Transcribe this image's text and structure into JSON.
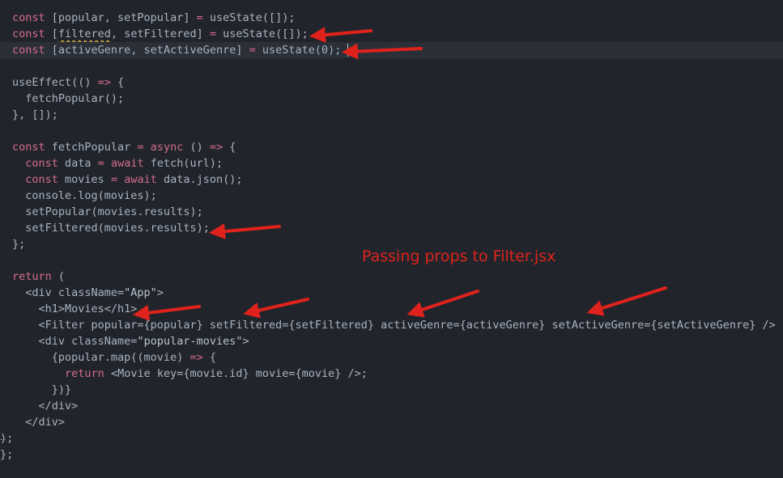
{
  "editor": {
    "lines": [
      [
        {
          "t": "const",
          "c": "kw"
        },
        {
          "t": " [popular, setPopular] "
        },
        {
          "t": "=",
          "c": "op"
        },
        {
          "t": " useState([]);"
        }
      ],
      [
        {
          "t": "const",
          "c": "kw"
        },
        {
          "t": " ["
        },
        {
          "t": "filtered",
          "c": "squiggle"
        },
        {
          "t": ", setFiltered] "
        },
        {
          "t": "=",
          "c": "op"
        },
        {
          "t": " useState([]);"
        }
      ],
      [
        {
          "t": "const",
          "c": "kw"
        },
        {
          "t": " [activeGenre, setActiveGenre] "
        },
        {
          "t": "=",
          "c": "op"
        },
        {
          "t": " useState(0);"
        },
        {
          "t": "",
          "c": "cursor"
        }
      ],
      [],
      [
        {
          "t": "useEffect(() "
        },
        {
          "t": "=>",
          "c": "op"
        },
        {
          "t": " {"
        }
      ],
      [
        {
          "t": "  fetchPopular();"
        }
      ],
      [
        {
          "t": "}, []);"
        }
      ],
      [],
      [
        {
          "t": "const",
          "c": "kw"
        },
        {
          "t": " fetchPopular "
        },
        {
          "t": "=",
          "c": "op"
        },
        {
          "t": " "
        },
        {
          "t": "async",
          "c": "kw"
        },
        {
          "t": " () "
        },
        {
          "t": "=>",
          "c": "op"
        },
        {
          "t": " {"
        }
      ],
      [
        {
          "t": "  "
        },
        {
          "t": "const",
          "c": "kw"
        },
        {
          "t": " data "
        },
        {
          "t": "=",
          "c": "op"
        },
        {
          "t": " "
        },
        {
          "t": "await",
          "c": "kw"
        },
        {
          "t": " fetch(url);"
        }
      ],
      [
        {
          "t": "  "
        },
        {
          "t": "const",
          "c": "kw"
        },
        {
          "t": " movies "
        },
        {
          "t": "=",
          "c": "op"
        },
        {
          "t": " "
        },
        {
          "t": "await",
          "c": "kw"
        },
        {
          "t": " data.json();"
        }
      ],
      [
        {
          "t": "  console.log(movies);"
        }
      ],
      [
        {
          "t": "  setPopular(movies.results);"
        }
      ],
      [
        {
          "t": "  setFiltered(movies.results);"
        }
      ],
      [
        {
          "t": "};"
        }
      ],
      [],
      [
        {
          "t": "return",
          "c": "kw"
        },
        {
          "t": " ("
        }
      ],
      [
        {
          "t": "  <div className="
        },
        {
          "t": "\"App\"",
          "c": "str"
        },
        {
          "t": ">"
        }
      ],
      [
        {
          "t": "    <h1>Movies</h1>"
        }
      ],
      [
        {
          "t": "    <Filter popular={popular} setFiltered={setFiltered} activeGenre={activeGenre} setActiveGenre={setActiveGenre} />"
        }
      ],
      [
        {
          "t": "    <div className="
        },
        {
          "t": "\"popular-movies\"",
          "c": "str"
        },
        {
          "t": ">"
        }
      ],
      [
        {
          "t": "      {popular.map((movie) "
        },
        {
          "t": "=>",
          "c": "op"
        },
        {
          "t": " {"
        }
      ],
      [
        {
          "t": "        "
        },
        {
          "t": "return",
          "c": "kw"
        },
        {
          "t": " <Movie key={movie.id} movie={movie} />;"
        }
      ],
      [
        {
          "t": "      })}"
        }
      ],
      [
        {
          "t": "    </div>"
        }
      ],
      [
        {
          "t": "  </div>"
        }
      ],
      [
        {
          "t": ");"
        }
      ],
      [
        {
          "t": "};"
        }
      ]
    ],
    "line_x": [
      15,
      15,
      15,
      15,
      15,
      15,
      15,
      15,
      15,
      15,
      15,
      15,
      15,
      15,
      15,
      15,
      15,
      15,
      15,
      15,
      15,
      15,
      15,
      15,
      15,
      15,
      -1,
      -1
    ],
    "active_line": 2
  },
  "annotation": {
    "text": "Passing props to Filter.jsx",
    "color": "#e0221c"
  }
}
